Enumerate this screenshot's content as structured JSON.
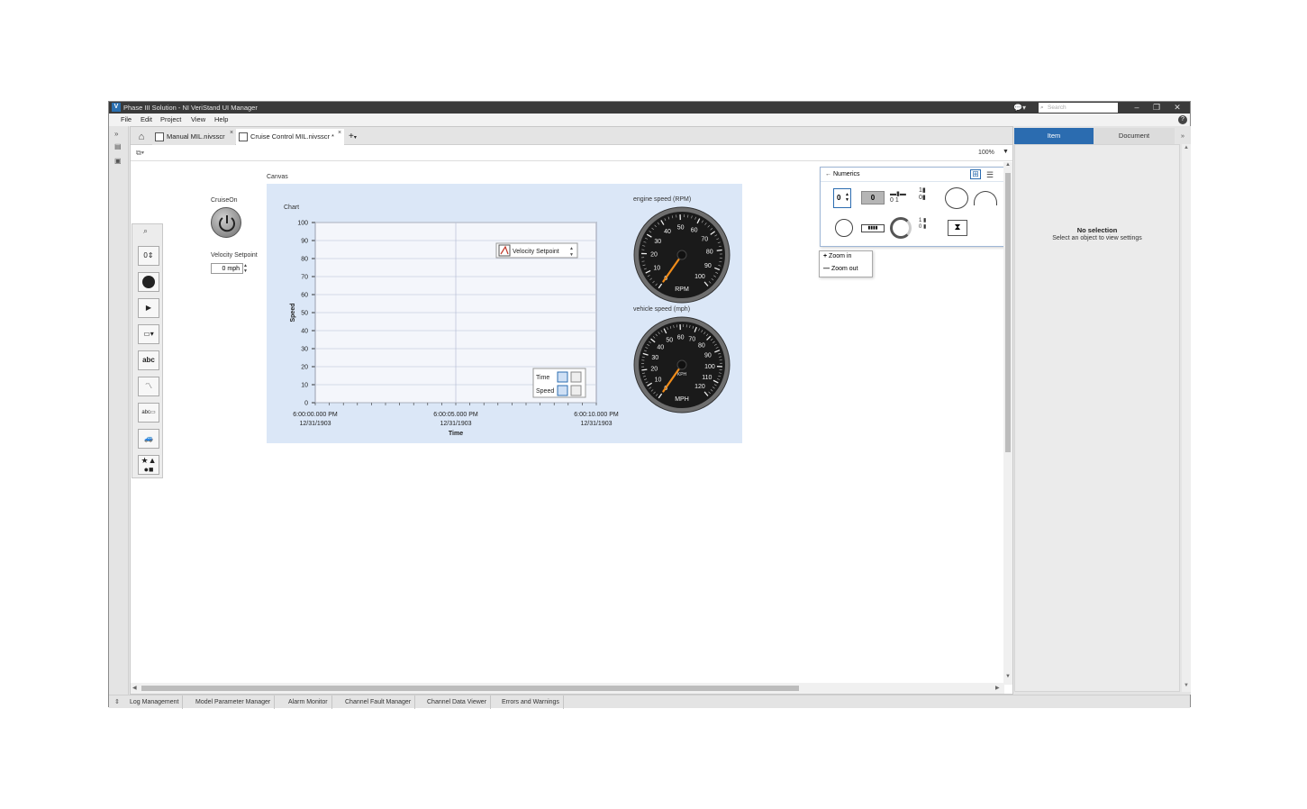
{
  "window": {
    "title": "Phase III Solution - NI VeriStand UI Manager",
    "app_icon_letter": "V",
    "search_placeholder": "Search",
    "minimize": "–",
    "restore": "❐",
    "close": "✕"
  },
  "menu": [
    "File",
    "Edit",
    "Project",
    "View",
    "Help"
  ],
  "tabs": [
    {
      "label": "Manual MIL.nivsscr",
      "close": "×"
    },
    {
      "label": "Cruise Control MIL.nivsscr *",
      "close": "×"
    }
  ],
  "add_tab": "+",
  "zoom_level": "100%",
  "labels": {
    "canvas": "Canvas",
    "chart": "Chart",
    "cruise_on": "CruiseOn",
    "velocity_setpoint": "Velocity Setpoint",
    "velocity_value": "0 mph"
  },
  "chart_data": {
    "type": "line",
    "title": "Chart",
    "xlabel": "Time",
    "ylabel": "Speed",
    "ylim": [
      0,
      100
    ],
    "y_ticks": [
      0,
      10,
      20,
      30,
      40,
      50,
      60,
      70,
      80,
      90,
      100
    ],
    "x_ticks": [
      {
        "time": "6:00:00.000 PM",
        "date": "12/31/1903"
      },
      {
        "time": "6:00:05.000 PM",
        "date": "12/31/1903"
      },
      {
        "time": "6:00:10.000 PM",
        "date": "12/31/1903"
      }
    ],
    "grid": true,
    "legend": {
      "position": "top-right",
      "entries": [
        "Velocity Setpoint"
      ]
    },
    "axis_controls": [
      "Time",
      "Speed"
    ],
    "series": [
      {
        "name": "Velocity Setpoint",
        "values": []
      }
    ]
  },
  "gauges": [
    {
      "title": "engine speed (RPM)",
      "unit": "RPM",
      "min": 0,
      "max": 100,
      "labels": [
        "0",
        "10",
        "20",
        "30",
        "40",
        "50",
        "60",
        "70",
        "80",
        "90",
        "100"
      ],
      "value": 0
    },
    {
      "title": "vehicle speed (mph)",
      "unit": "MPH",
      "sub_unit": "KPH",
      "min": 0,
      "max": 120,
      "labels": [
        "0",
        "10",
        "20",
        "30",
        "40",
        "50",
        "60",
        "70",
        "80",
        "90",
        "100",
        "110",
        "120"
      ],
      "value": 0
    }
  ],
  "numerics_popup": {
    "title": "Numerics",
    "numeric_value": "0",
    "indicator_value": "0"
  },
  "zoom_menu": [
    "Zoom in",
    "Zoom out"
  ],
  "right_panel": {
    "tabs": [
      "Item",
      "Document"
    ],
    "no_selection_title": "No selection",
    "no_selection_hint": "Select an object to view settings"
  },
  "bottom_tabs": [
    "Log Management",
    "Model Parameter Manager",
    "Alarm Monitor",
    "Channel Fault Manager",
    "Channel Data Viewer",
    "Errors and Warnings"
  ],
  "colors": {
    "accent": "#2b6cb0",
    "canvas_bg": "#dbe7f7",
    "needle": "#f08c1a"
  }
}
